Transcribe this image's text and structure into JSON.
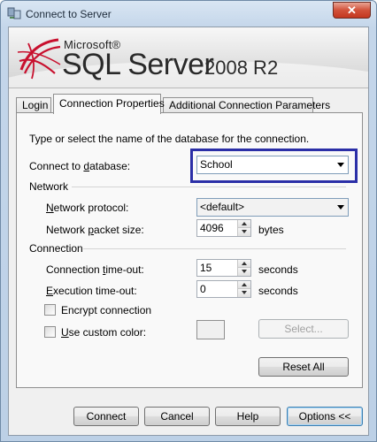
{
  "window": {
    "title": "Connect to Server",
    "close_glyph": "✕"
  },
  "banner": {
    "brand_top": "Microsoft®",
    "product": "SQL Server",
    "version": "2008 R2"
  },
  "tabs": [
    {
      "label": "Login",
      "active": false
    },
    {
      "label": "Connection Properties",
      "active": true
    },
    {
      "label": "Additional Connection Parameters",
      "active": false
    }
  ],
  "panel": {
    "instruction": "Type or select the name of the database for the connection.",
    "database_label": "Connect to database:",
    "database_value": "School",
    "network_group": "Network",
    "protocol_label": "Network protocol:",
    "protocol_value": "<default>",
    "packet_label": "Network packet size:",
    "packet_value": "4096",
    "packet_unit": "bytes",
    "connection_group": "Connection",
    "timeout_label": "Connection time-out:",
    "timeout_value": "15",
    "timeout_unit": "seconds",
    "exec_label": "Execution time-out:",
    "exec_value": "0",
    "exec_unit": "seconds",
    "encrypt_label": "Encrypt connection",
    "custom_color_label": "Use custom color:",
    "select_button": "Select...",
    "reset_button": "Reset All"
  },
  "footer": {
    "connect": "Connect",
    "cancel": "Cancel",
    "help": "Help",
    "options": "Options <<"
  },
  "colors": {
    "highlight": "#2b2fa7",
    "logo_red": "#c8102e"
  }
}
